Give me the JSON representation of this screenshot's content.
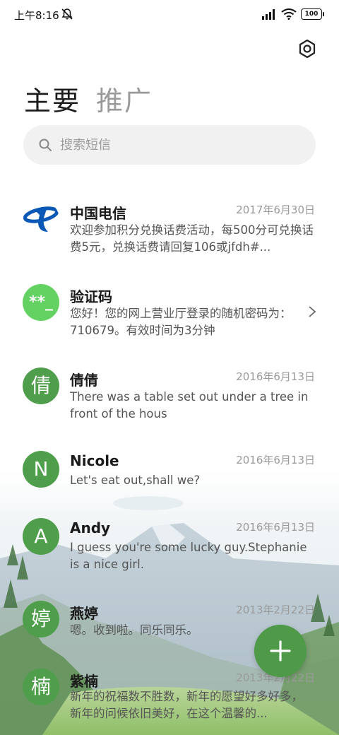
{
  "status": {
    "time": "上午8:16",
    "battery": "100"
  },
  "header": {
    "tabs": [
      {
        "label": "主要"
      },
      {
        "label": "推广"
      }
    ]
  },
  "search": {
    "placeholder": "搜索短信"
  },
  "messages": [
    {
      "name": "中国电信",
      "date": "2017年6月30日",
      "preview": "欢迎参加积分兑换话费活动，每500分可兑换话费5元，兑换话费请回复106或jfdh#...",
      "avatar": ""
    },
    {
      "name": "验证码",
      "date": "",
      "preview": "您好！您的网上营业厅登录的随机密码为：710679。有效时间为3分钟",
      "avatar": "**_"
    },
    {
      "name": "倩倩",
      "date": "2016年6月13日",
      "preview": "There was a table set out under a tree in front of the hous",
      "avatar": "倩"
    },
    {
      "name": "Nicole",
      "date": "2016年6月13日",
      "preview": "Let's eat out,shall we?",
      "avatar": "N"
    },
    {
      "name": "Andy",
      "date": "2016年6月13日",
      "preview": "I guess you're some lucky guy.Stephanie is a nice girl.",
      "avatar": "A"
    },
    {
      "name": "燕婷",
      "date": "2013年2月22日",
      "preview": "嗯。收到啦。同乐同乐。",
      "avatar": "婷"
    },
    {
      "name": "紫楠",
      "date": "2013年2月22日",
      "preview": "新年的祝福数不胜数，新年的愿望好多好多，新年的问候依旧美好，在这个温馨的...",
      "avatar": "楠"
    }
  ],
  "colors": {
    "avatar_green": "#4f9e4b",
    "avatar_light_green": "#64d262",
    "fab": "#4e9a48",
    "telecom_blue": "#0a58b5"
  }
}
